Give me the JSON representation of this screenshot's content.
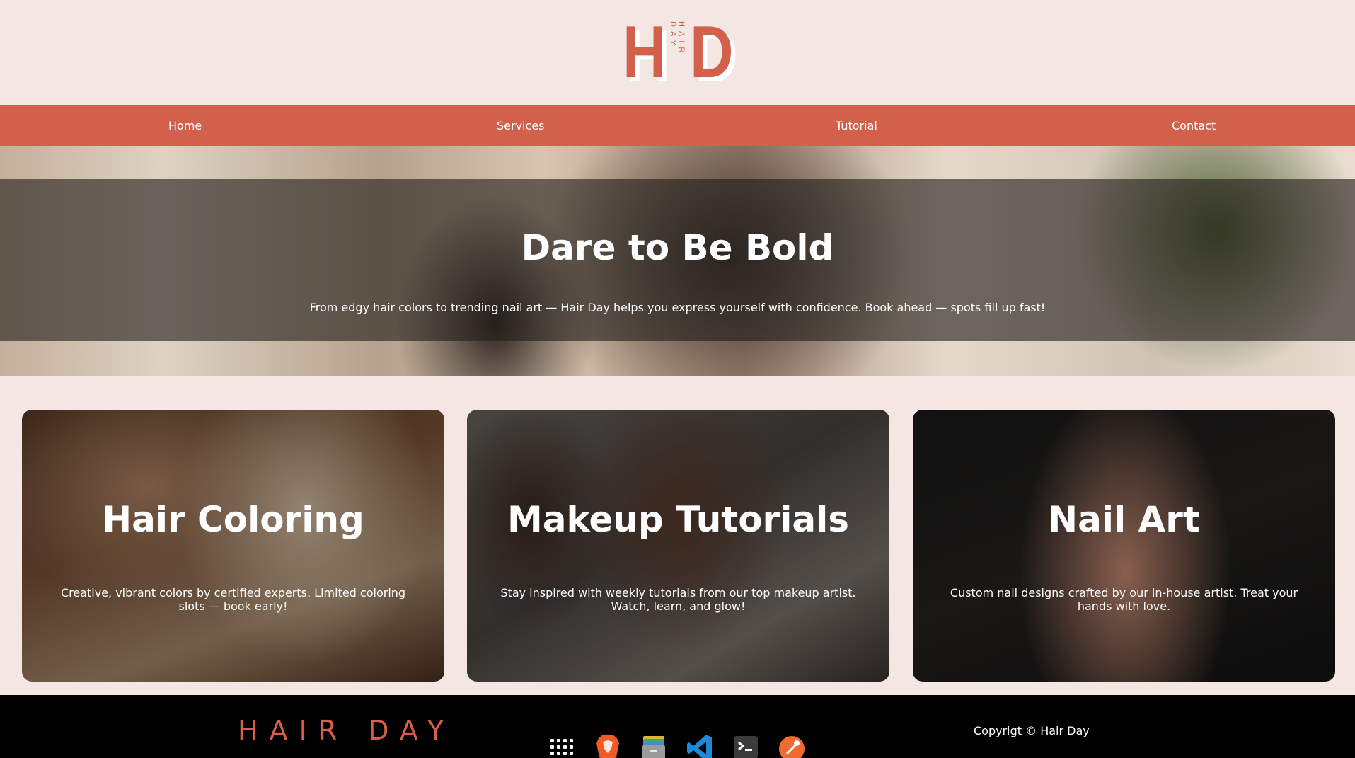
{
  "brand": {
    "logo_letter_1": "H",
    "logo_letter_2": "D",
    "logo_vertical": "HAIR DAY",
    "accent_color": "#d2604b",
    "background_color": "#f4e6e3"
  },
  "nav": {
    "items": [
      {
        "label": "Home"
      },
      {
        "label": "Services"
      },
      {
        "label": "Tutorial"
      },
      {
        "label": "Contact"
      }
    ]
  },
  "hero": {
    "title": "Dare to Be Bold",
    "text": "From edgy hair colors to trending nail art — Hair Day helps you express yourself with confidence. Book ahead — spots fill up fast!"
  },
  "cards": [
    {
      "title": "Hair Coloring",
      "text": "Creative, vibrant colors by certified experts. Limited coloring slots — book early!"
    },
    {
      "title": "Makeup Tutorials",
      "text": "Stay inspired with weekly tutorials from our top makeup artist. Watch, learn, and glow!"
    },
    {
      "title": "Nail Art",
      "text": "Custom nail designs crafted by our in-house artist. Treat your hands with love."
    }
  ],
  "footer": {
    "brand": "HAIR DAY",
    "copyright": "Copyrigt © Hair Day"
  },
  "taskbar": {
    "icons": [
      "apps-grid-icon",
      "brave-browser-icon",
      "files-icon",
      "vscode-icon",
      "terminal-icon",
      "postman-icon"
    ]
  }
}
